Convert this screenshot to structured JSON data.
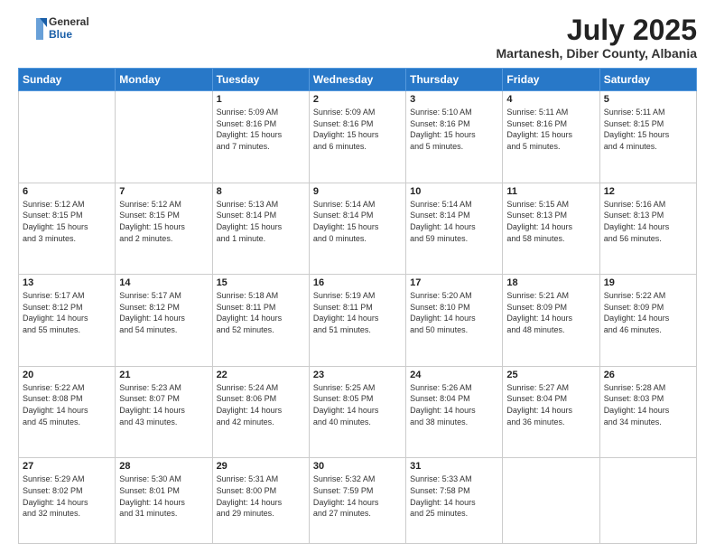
{
  "header": {
    "logo_general": "General",
    "logo_blue": "Blue",
    "title": "July 2025",
    "location": "Martanesh, Diber County, Albania"
  },
  "weekdays": [
    "Sunday",
    "Monday",
    "Tuesday",
    "Wednesday",
    "Thursday",
    "Friday",
    "Saturday"
  ],
  "weeks": [
    [
      {
        "day": "",
        "info": ""
      },
      {
        "day": "",
        "info": ""
      },
      {
        "day": "1",
        "info": "Sunrise: 5:09 AM\nSunset: 8:16 PM\nDaylight: 15 hours\nand 7 minutes."
      },
      {
        "day": "2",
        "info": "Sunrise: 5:09 AM\nSunset: 8:16 PM\nDaylight: 15 hours\nand 6 minutes."
      },
      {
        "day": "3",
        "info": "Sunrise: 5:10 AM\nSunset: 8:16 PM\nDaylight: 15 hours\nand 5 minutes."
      },
      {
        "day": "4",
        "info": "Sunrise: 5:11 AM\nSunset: 8:16 PM\nDaylight: 15 hours\nand 5 minutes."
      },
      {
        "day": "5",
        "info": "Sunrise: 5:11 AM\nSunset: 8:15 PM\nDaylight: 15 hours\nand 4 minutes."
      }
    ],
    [
      {
        "day": "6",
        "info": "Sunrise: 5:12 AM\nSunset: 8:15 PM\nDaylight: 15 hours\nand 3 minutes."
      },
      {
        "day": "7",
        "info": "Sunrise: 5:12 AM\nSunset: 8:15 PM\nDaylight: 15 hours\nand 2 minutes."
      },
      {
        "day": "8",
        "info": "Sunrise: 5:13 AM\nSunset: 8:14 PM\nDaylight: 15 hours\nand 1 minute."
      },
      {
        "day": "9",
        "info": "Sunrise: 5:14 AM\nSunset: 8:14 PM\nDaylight: 15 hours\nand 0 minutes."
      },
      {
        "day": "10",
        "info": "Sunrise: 5:14 AM\nSunset: 8:14 PM\nDaylight: 14 hours\nand 59 minutes."
      },
      {
        "day": "11",
        "info": "Sunrise: 5:15 AM\nSunset: 8:13 PM\nDaylight: 14 hours\nand 58 minutes."
      },
      {
        "day": "12",
        "info": "Sunrise: 5:16 AM\nSunset: 8:13 PM\nDaylight: 14 hours\nand 56 minutes."
      }
    ],
    [
      {
        "day": "13",
        "info": "Sunrise: 5:17 AM\nSunset: 8:12 PM\nDaylight: 14 hours\nand 55 minutes."
      },
      {
        "day": "14",
        "info": "Sunrise: 5:17 AM\nSunset: 8:12 PM\nDaylight: 14 hours\nand 54 minutes."
      },
      {
        "day": "15",
        "info": "Sunrise: 5:18 AM\nSunset: 8:11 PM\nDaylight: 14 hours\nand 52 minutes."
      },
      {
        "day": "16",
        "info": "Sunrise: 5:19 AM\nSunset: 8:11 PM\nDaylight: 14 hours\nand 51 minutes."
      },
      {
        "day": "17",
        "info": "Sunrise: 5:20 AM\nSunset: 8:10 PM\nDaylight: 14 hours\nand 50 minutes."
      },
      {
        "day": "18",
        "info": "Sunrise: 5:21 AM\nSunset: 8:09 PM\nDaylight: 14 hours\nand 48 minutes."
      },
      {
        "day": "19",
        "info": "Sunrise: 5:22 AM\nSunset: 8:09 PM\nDaylight: 14 hours\nand 46 minutes."
      }
    ],
    [
      {
        "day": "20",
        "info": "Sunrise: 5:22 AM\nSunset: 8:08 PM\nDaylight: 14 hours\nand 45 minutes."
      },
      {
        "day": "21",
        "info": "Sunrise: 5:23 AM\nSunset: 8:07 PM\nDaylight: 14 hours\nand 43 minutes."
      },
      {
        "day": "22",
        "info": "Sunrise: 5:24 AM\nSunset: 8:06 PM\nDaylight: 14 hours\nand 42 minutes."
      },
      {
        "day": "23",
        "info": "Sunrise: 5:25 AM\nSunset: 8:05 PM\nDaylight: 14 hours\nand 40 minutes."
      },
      {
        "day": "24",
        "info": "Sunrise: 5:26 AM\nSunset: 8:04 PM\nDaylight: 14 hours\nand 38 minutes."
      },
      {
        "day": "25",
        "info": "Sunrise: 5:27 AM\nSunset: 8:04 PM\nDaylight: 14 hours\nand 36 minutes."
      },
      {
        "day": "26",
        "info": "Sunrise: 5:28 AM\nSunset: 8:03 PM\nDaylight: 14 hours\nand 34 minutes."
      }
    ],
    [
      {
        "day": "27",
        "info": "Sunrise: 5:29 AM\nSunset: 8:02 PM\nDaylight: 14 hours\nand 32 minutes."
      },
      {
        "day": "28",
        "info": "Sunrise: 5:30 AM\nSunset: 8:01 PM\nDaylight: 14 hours\nand 31 minutes."
      },
      {
        "day": "29",
        "info": "Sunrise: 5:31 AM\nSunset: 8:00 PM\nDaylight: 14 hours\nand 29 minutes."
      },
      {
        "day": "30",
        "info": "Sunrise: 5:32 AM\nSunset: 7:59 PM\nDaylight: 14 hours\nand 27 minutes."
      },
      {
        "day": "31",
        "info": "Sunrise: 5:33 AM\nSunset: 7:58 PM\nDaylight: 14 hours\nand 25 minutes."
      },
      {
        "day": "",
        "info": ""
      },
      {
        "day": "",
        "info": ""
      }
    ]
  ]
}
